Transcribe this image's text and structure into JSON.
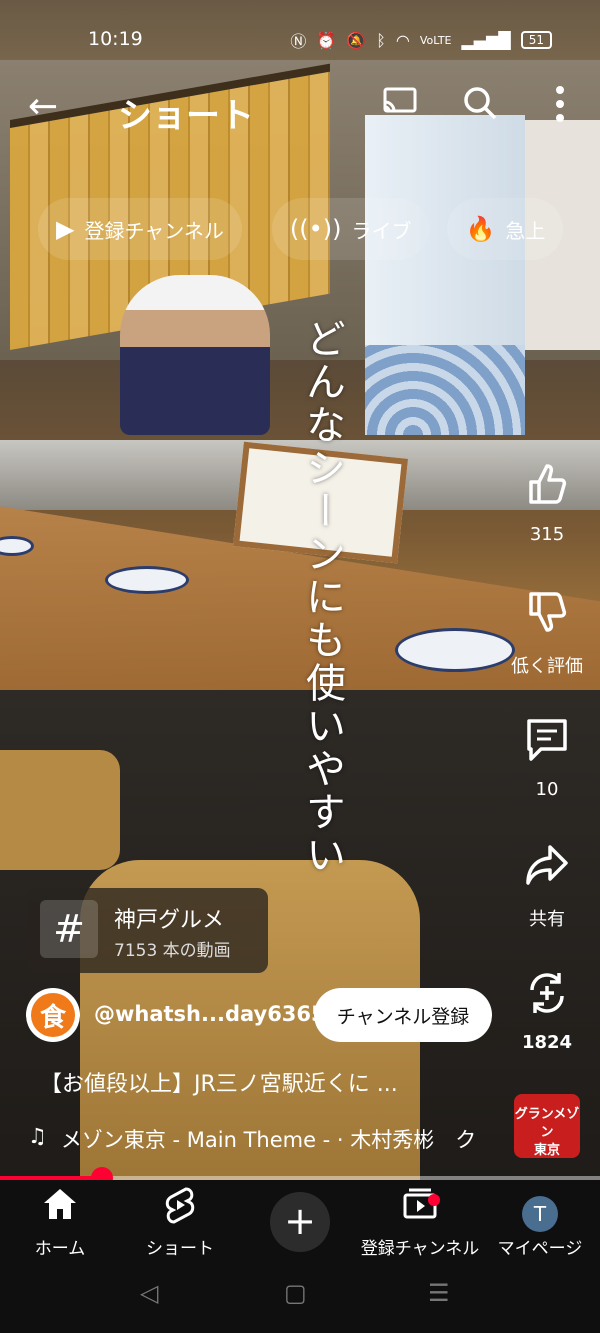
{
  "status_bar": {
    "time": "10:19",
    "icons": [
      "nfc-icon",
      "alarm-icon",
      "mute-icon",
      "bluetooth-icon",
      "wifi-icon",
      "volte-icon",
      "signal-icon"
    ],
    "battery": "51"
  },
  "top_bar": {
    "title": "ショート"
  },
  "chips": [
    {
      "label": "登録チャンネル",
      "icon": "subscriptions-icon"
    },
    {
      "label": "ライブ",
      "icon": "live-icon"
    },
    {
      "label": "急上",
      "icon": "trending-icon"
    }
  ],
  "overlay_text": "どんなシーンにも使いやすい",
  "actions": {
    "like": "315",
    "dislike": "低く評価",
    "comments": "10",
    "share": "共有",
    "remix": "1824"
  },
  "hashtag": {
    "symbol": "#",
    "name": "神戸グルメ",
    "count": "7153 本の動画"
  },
  "channel": {
    "avatar_char": "食",
    "handle": "@whatsh...day6365",
    "subscribe_label": "チャンネル登録"
  },
  "video": {
    "title": "【お値段以上】JR三ノ宮駅近くに ..."
  },
  "music": {
    "text": "メゾン東京 - Main Theme - · 木村秀彬　ク"
  },
  "sponsor": {
    "line1": "グランメゾン",
    "line2": "東京"
  },
  "progress": {
    "fraction": 0.17
  },
  "bottom_nav": {
    "home": "ホーム",
    "shorts": "ショート",
    "subscriptions": "登録チャンネル",
    "me": "マイページ",
    "me_initial": "T"
  },
  "colors": {
    "accent": "#ff0033",
    "nav_bg": "#0f0f0f",
    "avatar_orange": "#f07a1a"
  }
}
